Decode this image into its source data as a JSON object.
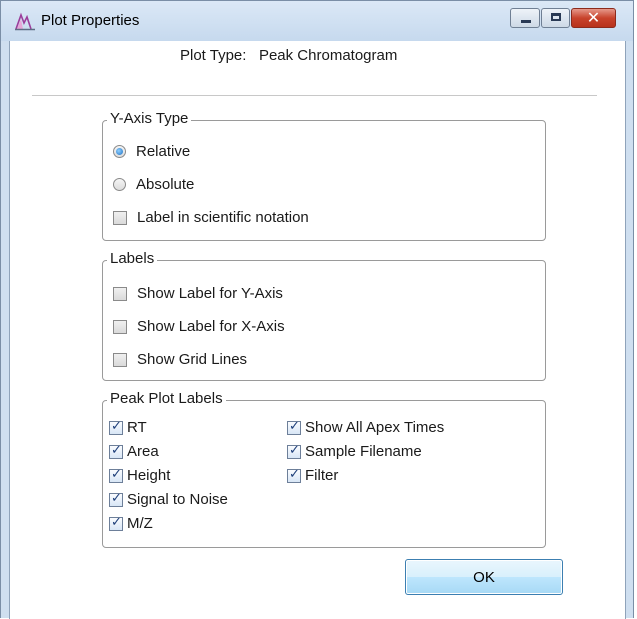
{
  "window": {
    "title": "Plot Properties",
    "icon": "peak-chart-icon",
    "controls": [
      "minimize-icon",
      "maximize-icon",
      "close-icon"
    ],
    "close_glyph": "✕"
  },
  "plot_type": {
    "label": "Plot Type:",
    "value": "Peak Chromatogram"
  },
  "y_axis_type": {
    "legend": "Y-Axis Type",
    "relative": {
      "label": "Relative",
      "selected": true
    },
    "absolute": {
      "label": "Absolute",
      "selected": false
    },
    "scientific": {
      "label": "Label in scientific notation",
      "checked": false
    }
  },
  "labels": {
    "legend": "Labels",
    "show_y": {
      "label": "Show Label for Y-Axis",
      "checked": false
    },
    "show_x": {
      "label": "Show Label for X-Axis",
      "checked": false
    },
    "grid": {
      "label": "Show Grid Lines",
      "checked": false
    }
  },
  "peak_plot_labels": {
    "legend": "Peak Plot Labels",
    "rt": {
      "label": "RT",
      "checked": true
    },
    "area": {
      "label": "Area",
      "checked": true
    },
    "height": {
      "label": "Height",
      "checked": true
    },
    "snr": {
      "label": "Signal to Noise",
      "checked": true
    },
    "mz": {
      "label": "M/Z",
      "checked": true
    },
    "apex": {
      "label": "Show All Apex Times",
      "checked": true
    },
    "filename": {
      "label": "Sample Filename",
      "checked": true
    },
    "filter": {
      "label": "Filter",
      "checked": true
    }
  },
  "ok_label": "OK",
  "colors": {
    "accent": "#1f6fc2",
    "frame": "#cfdff0",
    "close": "#c8432c"
  }
}
